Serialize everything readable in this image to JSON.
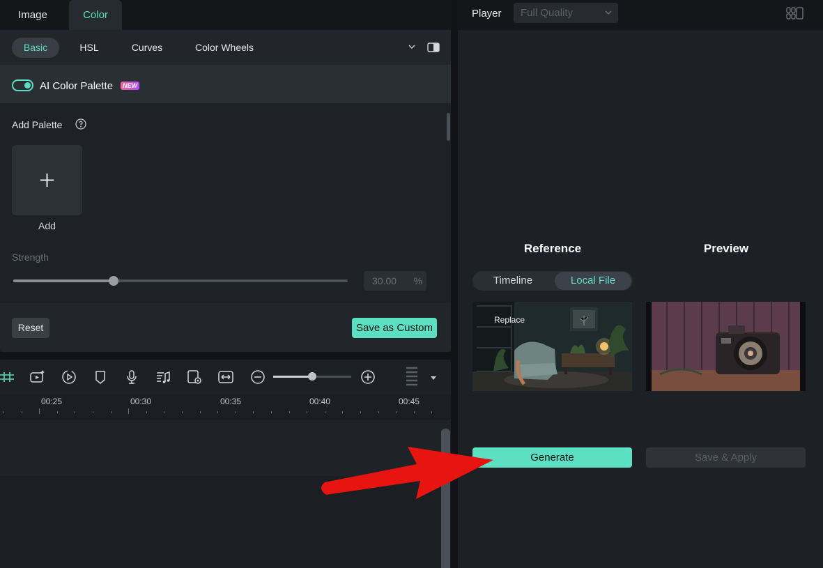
{
  "editor": {
    "top_tabs": [
      "Image",
      "Color"
    ],
    "sub_tabs": [
      "Basic",
      "HSL",
      "Curves",
      "Color Wheels"
    ],
    "ai_palette": {
      "label": "AI Color Palette",
      "badge": "NEW",
      "enabled": true
    },
    "add_palette": {
      "label": "Add Palette",
      "add_label": "Add"
    },
    "strength": {
      "label": "Strength",
      "value": "30.00",
      "unit": "%",
      "fraction": 0.3
    },
    "buttons": {
      "reset": "Reset",
      "save_custom": "Save as Custom"
    }
  },
  "timeline": {
    "ruler": [
      "00:25",
      "00:30",
      "00:35",
      "00:40",
      "00:45"
    ],
    "zoom_fraction": 0.5,
    "icons": [
      "snap-icon",
      "ai-clip-icon",
      "play-range-icon",
      "marker-icon",
      "mic-icon",
      "music-icon",
      "preview-icon",
      "fit-icon",
      "zoom-out-icon",
      "zoom-in-icon",
      "track-height-icon"
    ]
  },
  "player": {
    "label": "Player",
    "quality": "Full Quality",
    "reference": {
      "title": "Reference",
      "tabs": [
        "Timeline",
        "Local File"
      ],
      "active_tab": 1,
      "replace_label": "Replace"
    },
    "preview": {
      "title": "Preview"
    },
    "buttons": {
      "generate": "Generate",
      "save_apply": "Save & Apply"
    }
  },
  "colors": {
    "accent": "#5ce0c2",
    "arrow": "#e8140f"
  }
}
